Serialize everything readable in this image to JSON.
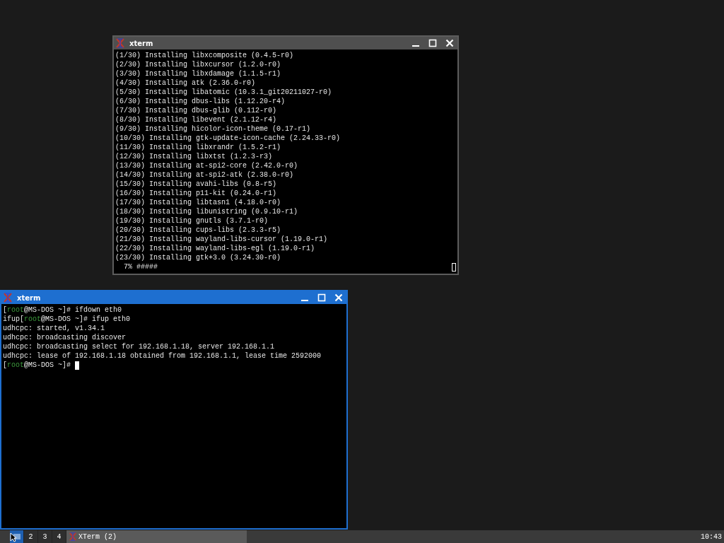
{
  "windows": [
    {
      "title": "xterm",
      "focused": false,
      "cursor_at_end": true,
      "lines": [
        [
          {
            "kind": "plain",
            "text": "(1/30) Installing libxcomposite (0.4.5-r0)"
          }
        ],
        [
          {
            "kind": "plain",
            "text": "(2/30) Installing libxcursor (1.2.0-r0)"
          }
        ],
        [
          {
            "kind": "plain",
            "text": "(3/30) Installing libxdamage (1.1.5-r1)"
          }
        ],
        [
          {
            "kind": "plain",
            "text": "(4/30) Installing atk (2.36.0-r0)"
          }
        ],
        [
          {
            "kind": "plain",
            "text": "(5/30) Installing libatomic (10.3.1_git20211027-r0)"
          }
        ],
        [
          {
            "kind": "plain",
            "text": "(6/30) Installing dbus-libs (1.12.20-r4)"
          }
        ],
        [
          {
            "kind": "plain",
            "text": "(7/30) Installing dbus-glib (0.112-r0)"
          }
        ],
        [
          {
            "kind": "plain",
            "text": "(8/30) Installing libevent (2.1.12-r4)"
          }
        ],
        [
          {
            "kind": "plain",
            "text": "(9/30) Installing hicolor-icon-theme (0.17-r1)"
          }
        ],
        [
          {
            "kind": "plain",
            "text": "(10/30) Installing gtk-update-icon-cache (2.24.33-r0)"
          }
        ],
        [
          {
            "kind": "plain",
            "text": "(11/30) Installing libxrandr (1.5.2-r1)"
          }
        ],
        [
          {
            "kind": "plain",
            "text": "(12/30) Installing libxtst (1.2.3-r3)"
          }
        ],
        [
          {
            "kind": "plain",
            "text": "(13/30) Installing at-spi2-core (2.42.0-r0)"
          }
        ],
        [
          {
            "kind": "plain",
            "text": "(14/30) Installing at-spi2-atk (2.38.0-r0)"
          }
        ],
        [
          {
            "kind": "plain",
            "text": "(15/30) Installing avahi-libs (0.8-r5)"
          }
        ],
        [
          {
            "kind": "plain",
            "text": "(16/30) Installing p11-kit (0.24.0-r1)"
          }
        ],
        [
          {
            "kind": "plain",
            "text": "(17/30) Installing libtasn1 (4.18.0-r0)"
          }
        ],
        [
          {
            "kind": "plain",
            "text": "(18/30) Installing libunistring (0.9.10-r1)"
          }
        ],
        [
          {
            "kind": "plain",
            "text": "(19/30) Installing gnutls (3.7.1-r0)"
          }
        ],
        [
          {
            "kind": "plain",
            "text": "(20/30) Installing cups-libs (2.3.3-r5)"
          }
        ],
        [
          {
            "kind": "plain",
            "text": "(21/30) Installing wayland-libs-cursor (1.19.0-r1)"
          }
        ],
        [
          {
            "kind": "plain",
            "text": "(22/30) Installing wayland-libs-egl (1.19.0-r1)"
          }
        ],
        [
          {
            "kind": "plain",
            "text": "(23/30) Installing gtk+3.0 (3.24.30-r0)"
          }
        ],
        [
          {
            "kind": "plain",
            "text": "  7% #####"
          }
        ]
      ]
    },
    {
      "title": "xterm",
      "focused": true,
      "cursor_at_end": false,
      "lines": [
        [
          {
            "kind": "plain",
            "text": "["
          },
          {
            "kind": "user",
            "text": "root"
          },
          {
            "kind": "plain",
            "text": "@MS-DOS ~]# ifdown eth0"
          }
        ],
        [
          {
            "kind": "plain",
            "text": "ifup["
          },
          {
            "kind": "user",
            "text": "root"
          },
          {
            "kind": "plain",
            "text": "@MS-DOS ~]# ifup eth0"
          }
        ],
        [
          {
            "kind": "plain",
            "text": "udhcpc: started, v1.34.1"
          }
        ],
        [
          {
            "kind": "plain",
            "text": "udhcpc: broadcasting discover"
          }
        ],
        [
          {
            "kind": "plain",
            "text": "udhcpc: broadcasting select for 192.168.1.18, server 192.168.1.1"
          }
        ],
        [
          {
            "kind": "plain",
            "text": "udhcpc: lease of 192.168.1.18 obtained from 192.168.1.1, lease time 2592000"
          }
        ],
        [
          {
            "kind": "plain",
            "text": "["
          },
          {
            "kind": "user",
            "text": "root"
          },
          {
            "kind": "plain",
            "text": "@MS-DOS ~]# "
          }
        ]
      ]
    }
  ],
  "taskbar": {
    "workspaces": [
      {
        "selected": true
      },
      {
        "label": "2",
        "selected": false
      },
      {
        "label": "3",
        "selected": false
      },
      {
        "label": "4",
        "selected": false
      }
    ],
    "tasks": [
      {
        "label": "XTerm (2)"
      }
    ],
    "clock": "10:43"
  }
}
